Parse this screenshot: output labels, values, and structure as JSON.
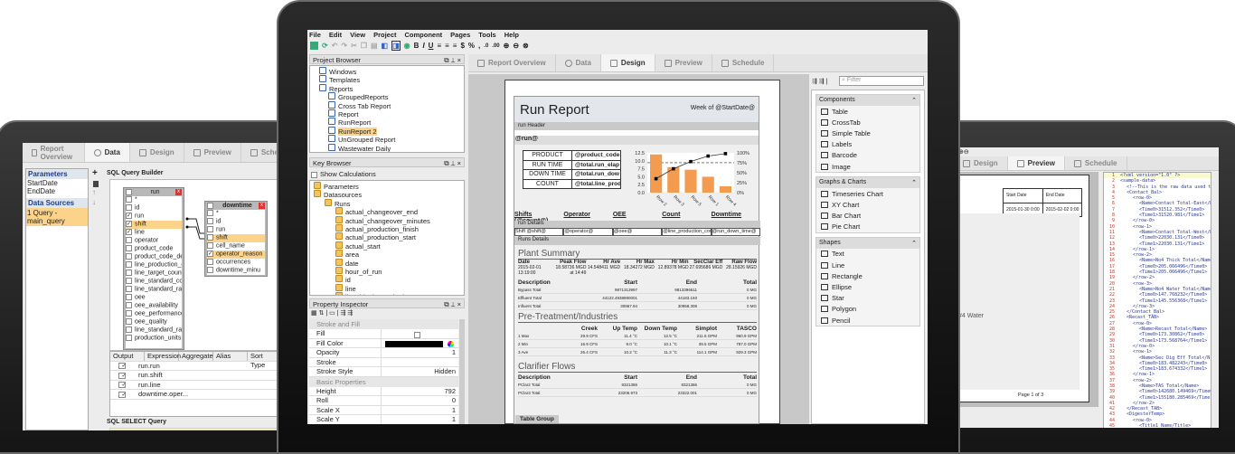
{
  "left_device": {
    "tabs": [
      "Report Overview",
      "Data",
      "Design",
      "Preview",
      "Schedule"
    ],
    "active_tab": 1,
    "parameters_header": "Parameters",
    "parameters": [
      "StartDate",
      "EndDate"
    ],
    "data_sources_header": "Data Sources",
    "data_sources": [
      "1 Query - main_query"
    ],
    "query_builder_label": "SQL Query Builder",
    "run_table": {
      "title": "run",
      "fields": [
        {
          "n": "*",
          "c": ""
        },
        {
          "n": "id",
          "c": ""
        },
        {
          "n": "run",
          "c": "✓"
        },
        {
          "n": "shift",
          "c": "✓"
        },
        {
          "n": "line",
          "c": "✓"
        },
        {
          "n": "operator",
          "c": ""
        },
        {
          "n": "product_code",
          "c": ""
        },
        {
          "n": "product_code_des",
          "c": ""
        },
        {
          "n": "line_production_co",
          "c": ""
        },
        {
          "n": "line_target_count",
          "c": ""
        },
        {
          "n": "line_standard_cou",
          "c": ""
        },
        {
          "n": "line_standard_rate",
          "c": ""
        },
        {
          "n": "oee",
          "c": ""
        },
        {
          "n": "oee_availability",
          "c": ""
        },
        {
          "n": "oee_performance",
          "c": ""
        },
        {
          "n": "oee_quality",
          "c": ""
        },
        {
          "n": "line_standard_rate",
          "c": ""
        },
        {
          "n": "production_units",
          "c": ""
        }
      ]
    },
    "downtime_table": {
      "title": "downtime",
      "fields": [
        {
          "n": "*",
          "c": ""
        },
        {
          "n": "id",
          "c": ""
        },
        {
          "n": "run",
          "c": ""
        },
        {
          "n": "shift",
          "c": ""
        },
        {
          "n": "cell_name",
          "c": ""
        },
        {
          "n": "operator_reason",
          "c": "✓"
        },
        {
          "n": "occurrences",
          "c": ""
        },
        {
          "n": "downtime_minu",
          "c": ""
        }
      ]
    },
    "grid_headers": [
      "Output",
      "Expression",
      "Aggregate",
      "Alias",
      "Sort Type"
    ],
    "grid_rows": [
      {
        "c": "✓",
        "e": "run.run"
      },
      {
        "c": "✓",
        "e": "run.shift"
      },
      {
        "c": "✓",
        "e": "run.line"
      },
      {
        "c": "✓",
        "e": "downtime.oper..."
      }
    ],
    "sql_select_label": "SQL SELECT Query"
  },
  "center": {
    "menu": [
      "File",
      "Edit",
      "View",
      "Project",
      "Component",
      "Pages",
      "Tools",
      "Help"
    ],
    "project_browser": {
      "title": "Project Browser",
      "items": [
        {
          "t": "Windows",
          "d": 1
        },
        {
          "t": "Templates",
          "d": 1
        },
        {
          "t": "Reports",
          "d": 1
        },
        {
          "t": "GroupedReports",
          "d": 2
        },
        {
          "t": "Cross Tab Report",
          "d": 2
        },
        {
          "t": "Report",
          "d": 2
        },
        {
          "t": "RunReport",
          "d": 2
        },
        {
          "t": "RunReport 2",
          "d": 2
        },
        {
          "t": "UnGrouped Report",
          "d": 2
        },
        {
          "t": "Wastewater Daily",
          "d": 2
        }
      ],
      "selected": 7
    },
    "key_browser": {
      "title": "Key Browser",
      "show_calc": "Show Calculations",
      "items": [
        {
          "t": "Parameters",
          "d": 0
        },
        {
          "t": "Datasources",
          "d": 0
        },
        {
          "t": "Runs",
          "d": 1
        },
        {
          "t": "actual_changeover_end",
          "d": 2
        },
        {
          "t": "actual_changeover_minutes",
          "d": 2
        },
        {
          "t": "actual_production_finish",
          "d": 2
        },
        {
          "t": "actual_production_start",
          "d": 2
        },
        {
          "t": "actual_start",
          "d": 2
        },
        {
          "t": "area",
          "d": 2
        },
        {
          "t": "date",
          "d": 2
        },
        {
          "t": "hour_of_run",
          "d": 2
        },
        {
          "t": "id",
          "d": 2
        },
        {
          "t": "line",
          "d": 2
        },
        {
          "t": "line_ideal_standard_count",
          "d": 2
        },
        {
          "t": "line_production_count",
          "d": 2
        }
      ]
    },
    "property_inspector": {
      "title": "Property Inspector",
      "sections": [
        {
          "name": "Stroke and Fill",
          "rows": [
            {
              "k": "Fill",
              "v": ""
            },
            {
              "k": "Fill Color",
              "v": ""
            },
            {
              "k": "Opacity",
              "v": "1"
            },
            {
              "k": "Stroke",
              "v": ""
            },
            {
              "k": "Stroke Style",
              "v": "Hidden"
            }
          ]
        },
        {
          "name": "Basic Properties",
          "rows": [
            {
              "k": "Height",
              "v": "792"
            },
            {
              "k": "Roll",
              "v": "0"
            },
            {
              "k": "Scale X",
              "v": "1"
            },
            {
              "k": "Scale Y",
              "v": "1"
            }
          ]
        }
      ]
    },
    "tabs": [
      "Report Overview",
      "Data",
      "Design",
      "Preview",
      "Schedule"
    ],
    "active_tab": 2,
    "report": {
      "title": "Run Report",
      "week": "Week of @StartDate@",
      "run_header": "run Header",
      "run_key": "@run@",
      "info": [
        {
          "k": "PRODUCT",
          "v": "@product_code"
        },
        {
          "k": "RUN TIME",
          "v": "@total.run_elap"
        },
        {
          "k": "DOWN TIME",
          "v": "@total.run_dow"
        },
        {
          "k": "COUNT",
          "v": "@total.line_prod"
        }
      ],
      "detail_headers": [
        "Shifts (@count@)",
        "Operator",
        "OEE",
        "Count",
        "Downtime"
      ],
      "run_details": "run Details",
      "detail_row": [
        "Shift @shift@",
        "@operator@",
        "@oee@",
        "@line_production_count@",
        "@run_down_time@"
      ],
      "runs_details": "Runs Details",
      "plant_summary": {
        "title": "Plant Summary",
        "headers": [
          "Date",
          "Peak Flow",
          "Hr Ave",
          "Hr Max",
          "Hr Min",
          "SecClar Eff",
          "Raw Flow"
        ],
        "row": [
          "2015-02-01 13:19:00",
          "18.58736 MGD at 14:49",
          "14.548411 MGD",
          "18.34272 MGD",
          "12.89378 MGD",
          "27.695686 MGD",
          "28.15926 MGD"
        ],
        "t_headers": [
          "Description",
          "Start",
          "End",
          "Total"
        ],
        "t_rows": [
          [
            "Bypass Total",
            "9871313997",
            "9813396611",
            "0 MG"
          ],
          [
            "Effluent Total",
            "44122.4938890001",
            "44183.193",
            "0 MG"
          ],
          [
            "Influent Total",
            "30967.94",
            "30958.308",
            "0 MG"
          ]
        ]
      },
      "pretreatment": {
        "title": "Pre-Treatment/Industries",
        "headers": [
          "",
          "Creek",
          "Up Temp",
          "Down Temp",
          "Simplot",
          "TASCO"
        ],
        "rows": [
          [
            "1 Max",
            "29.9 CFS",
            "11.4 °C",
            "12.5 °C",
            "211.5 GPM",
            "960.9 GPM"
          ],
          [
            "2 Min",
            "16.9 CFS",
            "9.0 °C",
            "10.1 °C",
            "39.5 GPM",
            "787.0 GPM"
          ],
          [
            "3 Ave",
            "26.4 CFS",
            "10.2 °C",
            "11.3 °C",
            "114.1 GPM",
            "929.3 GPM"
          ]
        ]
      },
      "clarifier": {
        "title": "Clarifier Flows",
        "headers": [
          "Description",
          "Start",
          "End",
          "Total"
        ],
        "rows": [
          [
            "PClar2 Total",
            "8321386",
            "8321386",
            "0 MG"
          ],
          [
            "PClar3 Total",
            "23206.973",
            "23322.001",
            "0 MG"
          ]
        ]
      },
      "table_group": "Table Group"
    },
    "filter_placeholder": "Filter",
    "palette": [
      {
        "name": "Components",
        "items": [
          "Table",
          "CrossTab",
          "Simple Table",
          "Labels",
          "Barcode",
          "Image"
        ]
      },
      {
        "name": "Graphs & Charts",
        "items": [
          "Timeseries Chart",
          "XY Chart",
          "Bar Chart",
          "Pie Chart"
        ]
      },
      {
        "name": "Shapes",
        "items": [
          "Text",
          "Line",
          "Rectangle",
          "Ellipse",
          "Star",
          "Polygon",
          "Pencil"
        ]
      }
    ]
  },
  "chart_data": {
    "type": "bar",
    "categories": [
      "Row 2",
      "Row 3",
      "Row 5",
      "Row 1",
      "Row 4"
    ],
    "values": [
      12,
      8,
      7.2,
      5,
      2
    ],
    "cumulative_pct": [
      35,
      60,
      78,
      92,
      98
    ],
    "ylim": [
      0,
      12.5
    ],
    "y_ticks": [
      "12.5",
      "10.0",
      "7.5",
      "5.0",
      "2.5",
      "0.0"
    ],
    "y2_ticks": [
      "100%",
      "75%",
      "50%",
      "25%",
      "0%"
    ],
    "bar_color": "#f39c4f"
  },
  "right_device": {
    "tabs": [
      "Design",
      "Preview",
      "Schedule"
    ],
    "active_tab": 1,
    "dates": {
      "h": [
        "Start Date",
        "End Date"
      ],
      "v": [
        "2015-01-30 0:00",
        "2015-02-02 0:00"
      ]
    },
    "water_heading": "#4 Water",
    "page_label": "Page 1 of 3",
    "xml": [
      "<?xml version=\"1.0\" ?>",
      "<sample-data>",
      "<!--This is the raw data used to c",
      "<Contact_Bal>",
      "<row-0>",
      "<Name>Contact Total-East</N",
      "<Time0>31512.352</Time0>",
      "<Time1>31520.981</Time1>",
      "</row-0>",
      "<row-1>",
      "<Name>Contact Total-West</N",
      "<Time0>22030.131</Time0>",
      "<Time1>22030.131</Time1>",
      "</row-1>",
      "<row-2>",
      "<Name>No4 Thick Total</Name",
      "<Time0>205.066496</Time0>",
      "<Time1>205.066496</Time1>",
      "</row-2>",
      "<row-3>",
      "<Name>No4 Water Total</Name",
      "<Time0>147.768232</Time0>",
      "<Time1>145.556368</Time1>",
      "</row-3>",
      "</Contact_Bal>",
      "<Recast_TAB>",
      "<row-0>",
      "<Name>Recast Total</Name>",
      "<Time0>173.30862</Time0>",
      "<Time1>173.568764</Time1>",
      "</row-0>",
      "<row-1>",
      "<Name>Sec Dig Eff Total</N",
      "<Time0>183.482243</Time0>",
      "<Time1>183.674332</Time1>",
      "</row-1>",
      "<row-2>",
      "<Name>TAS Total</Name>",
      "<Time0>142680.149469</Time0",
      "<Time1>155180.285469</Time1",
      "</row-2>",
      "</Recast_TAB>",
      "<DigesterTemp>",
      "<row-0>",
      "<Title1_Name/Title>"
    ]
  }
}
